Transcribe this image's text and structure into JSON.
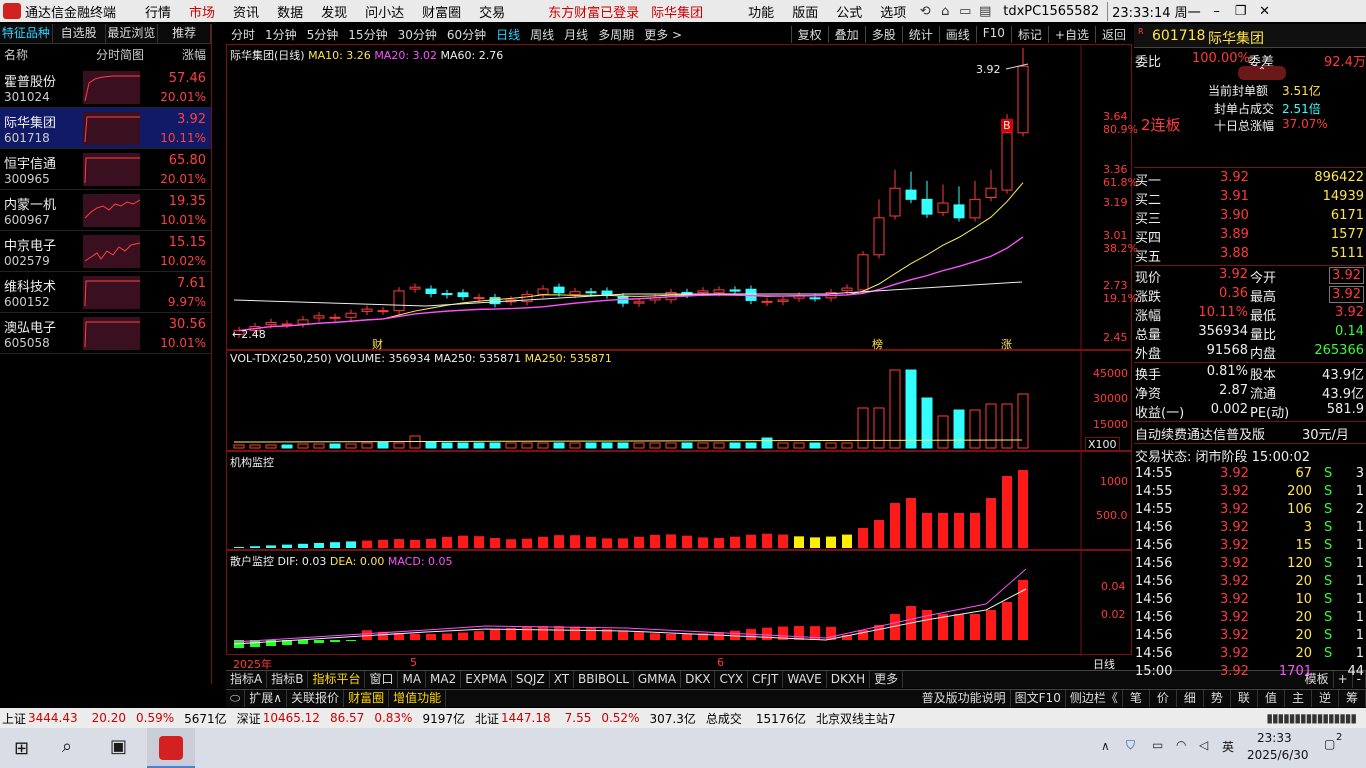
{
  "app": {
    "title": "通达信金融终端",
    "menus": [
      "行情",
      "市场",
      "资讯",
      "数据",
      "发现",
      "问小达",
      "财富圈",
      "交易"
    ],
    "active_menu": "市场",
    "login_text": "东方财富已登录",
    "login_stock": "际华集团",
    "right_menus": [
      "功能",
      "版面",
      "公式",
      "选项"
    ],
    "user": "tdxPC1565582",
    "clock": "23:33:14 周一"
  },
  "sidebar": {
    "tabs": [
      "特征品种",
      "自选股",
      "最近浏览",
      "推荐"
    ],
    "headers": [
      "名称",
      "分时简图",
      "涨幅"
    ],
    "stocks": [
      {
        "name": "霍普股份",
        "code": "301024",
        "price": "57.46",
        "pct": "20.01%"
      },
      {
        "name": "际华集团",
        "code": "601718",
        "price": "3.92",
        "pct": "10.11%"
      },
      {
        "name": "恒宇信通",
        "code": "300965",
        "price": "65.80",
        "pct": "20.01%"
      },
      {
        "name": "内蒙一机",
        "code": "600967",
        "price": "19.35",
        "pct": "10.01%"
      },
      {
        "name": "中京电子",
        "code": "002579",
        "price": "15.15",
        "pct": "10.02%"
      },
      {
        "name": "维科技术",
        "code": "600152",
        "price": "7.61",
        "pct": "9.97%"
      },
      {
        "name": "澳弘电子",
        "code": "605058",
        "price": "30.56",
        "pct": "10.01%"
      }
    ]
  },
  "toolbar": {
    "periods": [
      "分时",
      "1分钟",
      "5分钟",
      "15分钟",
      "30分钟",
      "60分钟",
      "日线",
      "周线",
      "月线",
      "多周期",
      "更多 >"
    ],
    "selected": "日线",
    "right": [
      "复权",
      "叠加",
      "多股",
      "统计",
      "画线",
      "F10",
      "标记",
      "+自选",
      "返回"
    ]
  },
  "kchart": {
    "title": "际华集团(日线)",
    "ma10": "MA10: 3.26",
    "ma20": "MA20: 3.02",
    "ma60": "MA60: 2.76",
    "high_mark": "3.92",
    "low_mark": "2.48",
    "marker_b": "B",
    "marker_cai": "财",
    "marker_bang": "榜",
    "marker_zhang": "涨",
    "yaxis": [
      {
        "v": "3.64",
        "p": "80.9%"
      },
      {
        "v": "3.36",
        "p": "61.8%"
      },
      {
        "v": "3.19",
        "p": ""
      },
      {
        "v": "3.01",
        "p": "38.2%"
      },
      {
        "v": "2.73",
        "p": "19.1%"
      },
      {
        "v": "2.45",
        "p": ""
      }
    ]
  },
  "volume": {
    "label": "VOL-TDX(250,250)",
    "vol": "VOLUME: 356934",
    "ma1": "MA250: 535871",
    "ma2": "MA250: 535871",
    "yaxis": [
      "45000",
      "30000",
      "15000"
    ],
    "unit": "X100"
  },
  "inst": {
    "label": "机构监控",
    "yaxis": [
      "1000",
      "500.0"
    ]
  },
  "retail": {
    "label": "散户监控",
    "dif": "DIF: 0.03",
    "dea": "DEA: 0.00",
    "macd": "MACD: 0.05",
    "yaxis": [
      "0.04",
      "0.02"
    ]
  },
  "xaxis": {
    "labels": [
      "2025年",
      "5",
      "6"
    ],
    "period": "日线"
  },
  "bottom_tabs": [
    "指标A",
    "指标B",
    "指标平台",
    "窗口",
    "MA",
    "MA2",
    "EXPMA",
    "SQJZ",
    "XT",
    "BBIBOLL",
    "GMMA",
    "DKX",
    "CYX",
    "CFJT",
    "WAVE",
    "DKXH",
    "更多",
    "模板",
    "+",
    "-"
  ],
  "bottom_tabs2": [
    "扩展∧",
    "关联报价",
    "财富圈",
    "增值功能"
  ],
  "bottom_right": [
    "普及版功能说明",
    "图文F10",
    "侧边栏《",
    "笔",
    "价",
    "细",
    "势",
    "联",
    "值",
    "主",
    "逆",
    "筹"
  ],
  "quote": {
    "code": "601718",
    "name": "际华集团",
    "weibi_label": "委比",
    "weibi": "100.00%",
    "weicha_label": "委差",
    "weicha": "92.4万",
    "seal_amt_label": "当前封单额",
    "seal_amt": "3.51亿",
    "seal_ratio_label": "封单占成交",
    "seal_ratio": "2.51倍",
    "ten_day_label": "十日总涨幅",
    "ten_day": "37.07%",
    "lianban": "2连板",
    "bids": [
      {
        "l": "买一",
        "p": "3.92",
        "v": "896422"
      },
      {
        "l": "买二",
        "p": "3.91",
        "v": "14939"
      },
      {
        "l": "买三",
        "p": "3.90",
        "v": "6171"
      },
      {
        "l": "买四",
        "p": "3.89",
        "v": "1577"
      },
      {
        "l": "买五",
        "p": "3.88",
        "v": "5111"
      }
    ],
    "stats": [
      {
        "l1": "现价",
        "v1": "3.92",
        "l2": "今开",
        "v2": "3.92"
      },
      {
        "l1": "涨跌",
        "v1": "0.36",
        "l2": "最高",
        "v2": "3.92"
      },
      {
        "l1": "涨幅",
        "v1": "10.11%",
        "l2": "最低",
        "v2": "3.92"
      },
      {
        "l1": "总量",
        "v1": "356934",
        "l2": "量比",
        "v2": "0.14"
      },
      {
        "l1": "外盘",
        "v1": "91568",
        "l2": "内盘",
        "v2": "265366"
      }
    ],
    "stats2": [
      {
        "l1": "换手",
        "v1": "0.81%",
        "l2": "股本",
        "v2": "43.9亿"
      },
      {
        "l1": "净资",
        "v1": "2.87",
        "l2": "流通",
        "v2": "43.9亿"
      },
      {
        "l1": "收益(一)",
        "v1": "0.002",
        "l2": "PE(动)",
        "v2": "581.9"
      }
    ],
    "promo": "自动续费通达信普及版",
    "promo_price": "30元/月",
    "trade_state": "交易状态: 闭市阶段 15:00:02",
    "ticks": [
      {
        "t": "14:55",
        "p": "3.92",
        "v": "67",
        "s": "S",
        "n": "3"
      },
      {
        "t": "14:55",
        "p": "3.92",
        "v": "200",
        "s": "S",
        "n": "1"
      },
      {
        "t": "14:55",
        "p": "3.92",
        "v": "106",
        "s": "S",
        "n": "2"
      },
      {
        "t": "14:56",
        "p": "3.92",
        "v": "3",
        "s": "S",
        "n": "1"
      },
      {
        "t": "14:56",
        "p": "3.92",
        "v": "15",
        "s": "S",
        "n": "1"
      },
      {
        "t": "14:56",
        "p": "3.92",
        "v": "120",
        "s": "S",
        "n": "1"
      },
      {
        "t": "14:56",
        "p": "3.92",
        "v": "20",
        "s": "S",
        "n": "1"
      },
      {
        "t": "14:56",
        "p": "3.92",
        "v": "10",
        "s": "S",
        "n": "1"
      },
      {
        "t": "14:56",
        "p": "3.92",
        "v": "20",
        "s": "S",
        "n": "1"
      },
      {
        "t": "14:56",
        "p": "3.92",
        "v": "20",
        "s": "S",
        "n": "1"
      },
      {
        "t": "14:56",
        "p": "3.92",
        "v": "20",
        "s": "S",
        "n": "1"
      },
      {
        "t": "15:00",
        "p": "3.92",
        "v": "1701",
        "s": "",
        "n": "44"
      }
    ]
  },
  "status": {
    "sh_label": "上证",
    "sh": "3444.43",
    "sh_chg": "20.20",
    "sh_pct": "0.59%",
    "sh_amt": "5671亿",
    "sz_label": "深证",
    "sz": "10465.12",
    "sz_chg": "86.57",
    "sz_pct": "0.83%",
    "sz_amt": "9197亿",
    "bz_label": "北证",
    "bz": "1447.18",
    "bz_chg": "7.55",
    "bz_pct": "0.52%",
    "bz_amt": "307.3亿",
    "total_label": "总成交",
    "total": "15176亿",
    "server": "北京双线主站7"
  },
  "taskbar": {
    "time": "23:33",
    "date": "2025/6/30",
    "ime": "英",
    "notif": "2"
  },
  "colors": {
    "up": "#ff3a3a",
    "down": "#3ff",
    "bg": "#000000",
    "border": "#7a1010"
  }
}
